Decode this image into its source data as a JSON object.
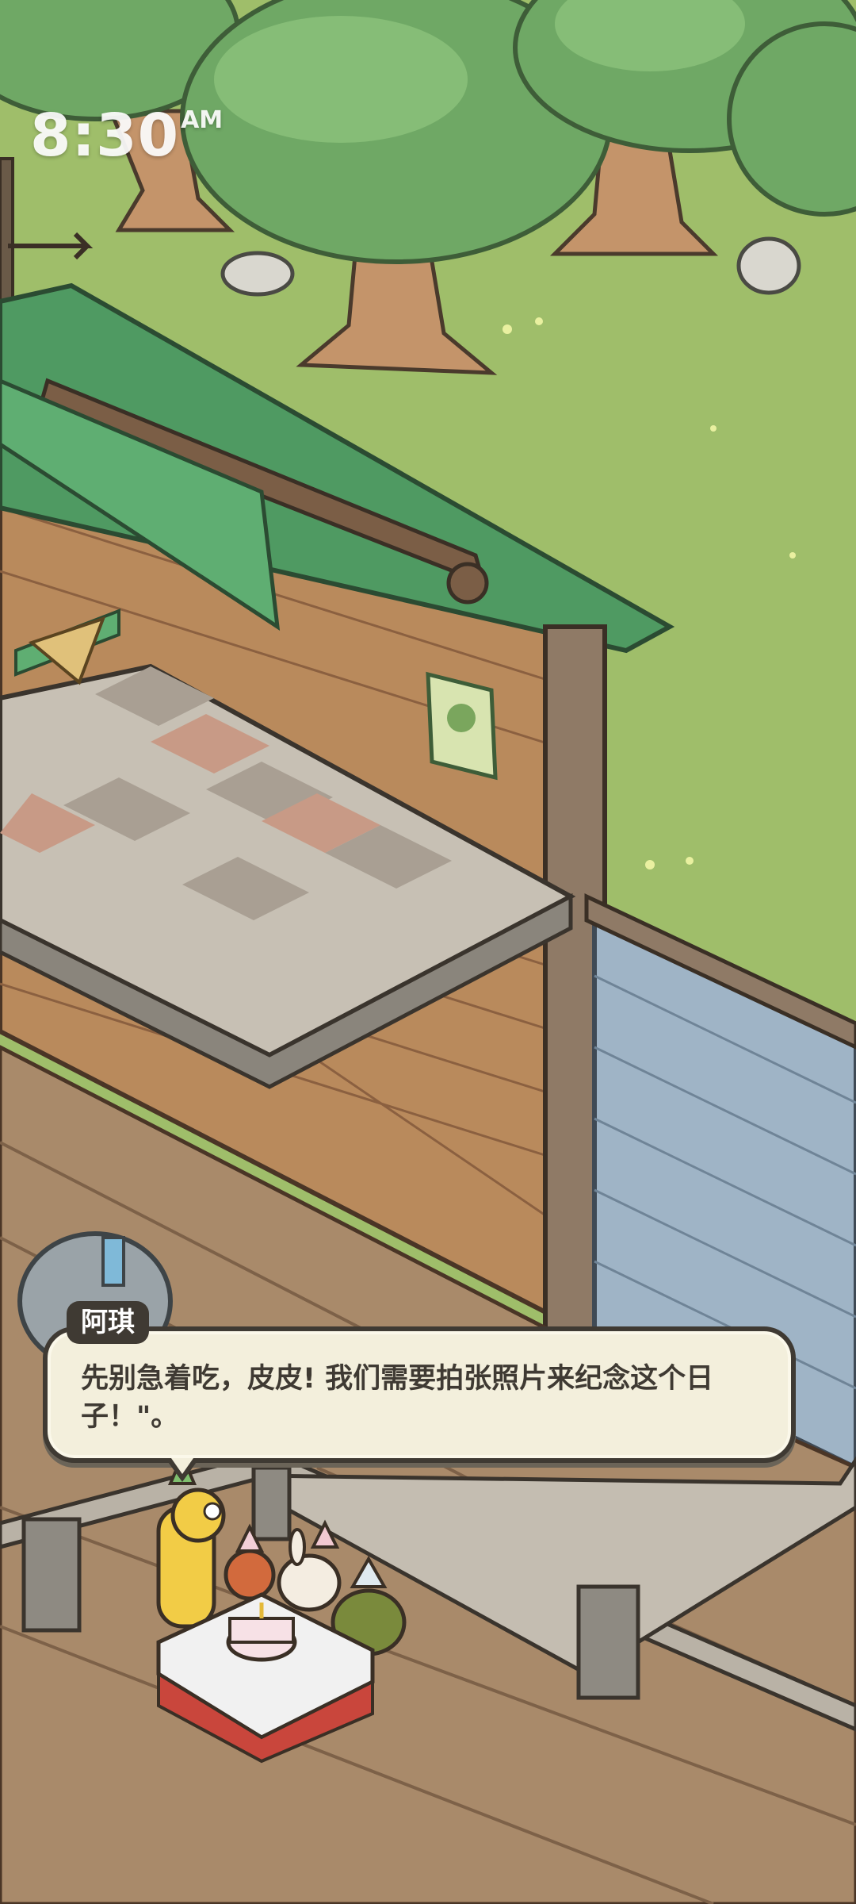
{
  "status_bar": {
    "time": "8:30",
    "ampm": "AM"
  },
  "dialog": {
    "speaker": "阿琪",
    "text": "先别急着吃，皮皮! 我们需要拍张照片来纪念这个日子！\"。"
  },
  "colors": {
    "grass": "#9fbe6a",
    "roof": "#4f9a62",
    "brick": "#b98a5c",
    "stone_wall": "#9fb4c6",
    "floor": "#a98a6a",
    "dialog_bg": "#f3efdc",
    "dialog_border": "#3f3a33"
  }
}
